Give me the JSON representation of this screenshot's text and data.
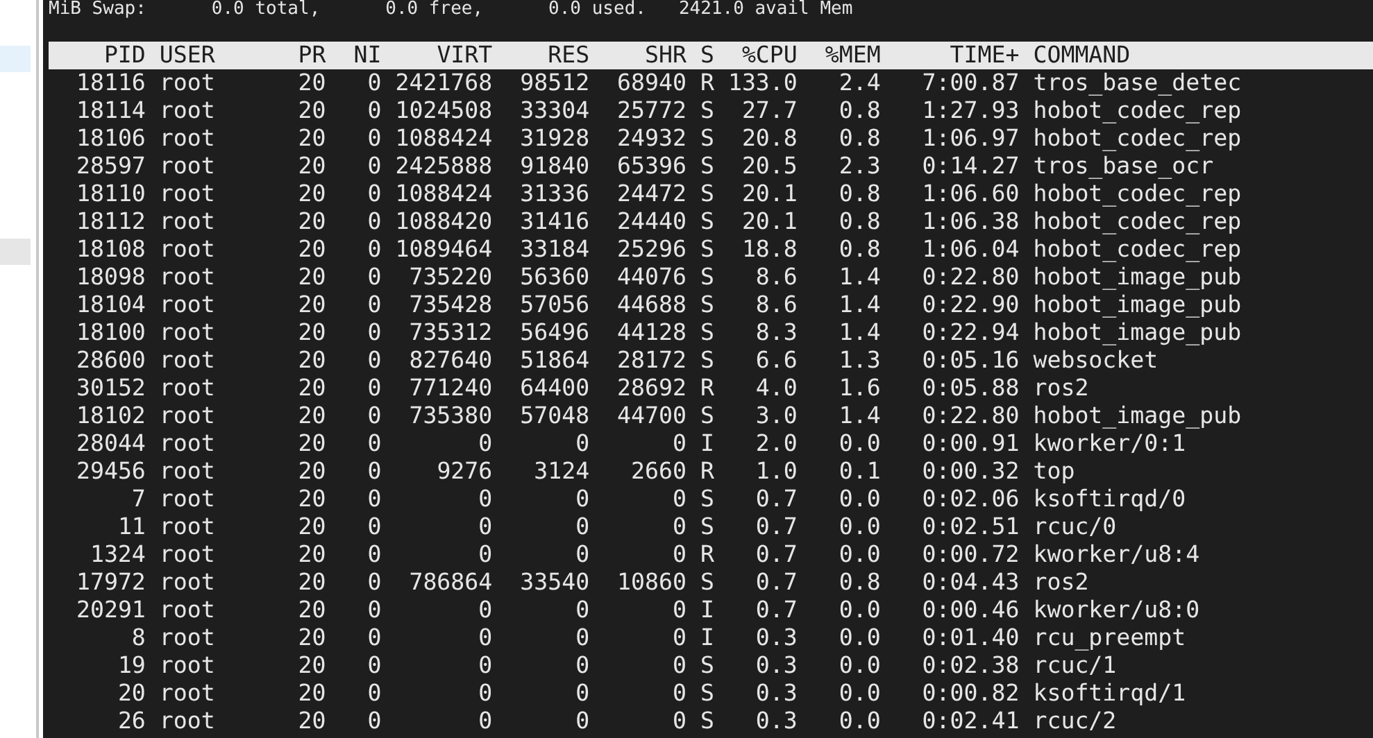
{
  "summary_line": "MiB Swap:      0.0 total,      0.0 free,      0.0 used.   2421.0 avail Mem",
  "columns": [
    "PID",
    "USER",
    "PR",
    "NI",
    "VIRT",
    "RES",
    "SHR",
    "S",
    "%CPU",
    "%MEM",
    "TIME+",
    "COMMAND"
  ],
  "rows": [
    [
      "18116",
      "root",
      "20",
      "0",
      "2421768",
      "98512",
      "68940",
      "R",
      "133.0",
      "2.4",
      "7:00.87",
      "tros_base_detec"
    ],
    [
      "18114",
      "root",
      "20",
      "0",
      "1024508",
      "33304",
      "25772",
      "S",
      "27.7",
      "0.8",
      "1:27.93",
      "hobot_codec_rep"
    ],
    [
      "18106",
      "root",
      "20",
      "0",
      "1088424",
      "31928",
      "24932",
      "S",
      "20.8",
      "0.8",
      "1:06.97",
      "hobot_codec_rep"
    ],
    [
      "28597",
      "root",
      "20",
      "0",
      "2425888",
      "91840",
      "65396",
      "S",
      "20.5",
      "2.3",
      "0:14.27",
      "tros_base_ocr"
    ],
    [
      "18110",
      "root",
      "20",
      "0",
      "1088424",
      "31336",
      "24472",
      "S",
      "20.1",
      "0.8",
      "1:06.60",
      "hobot_codec_rep"
    ],
    [
      "18112",
      "root",
      "20",
      "0",
      "1088420",
      "31416",
      "24440",
      "S",
      "20.1",
      "0.8",
      "1:06.38",
      "hobot_codec_rep"
    ],
    [
      "18108",
      "root",
      "20",
      "0",
      "1089464",
      "33184",
      "25296",
      "S",
      "18.8",
      "0.8",
      "1:06.04",
      "hobot_codec_rep"
    ],
    [
      "18098",
      "root",
      "20",
      "0",
      "735220",
      "56360",
      "44076",
      "S",
      "8.6",
      "1.4",
      "0:22.80",
      "hobot_image_pub"
    ],
    [
      "18104",
      "root",
      "20",
      "0",
      "735428",
      "57056",
      "44688",
      "S",
      "8.6",
      "1.4",
      "0:22.90",
      "hobot_image_pub"
    ],
    [
      "18100",
      "root",
      "20",
      "0",
      "735312",
      "56496",
      "44128",
      "S",
      "8.3",
      "1.4",
      "0:22.94",
      "hobot_image_pub"
    ],
    [
      "28600",
      "root",
      "20",
      "0",
      "827640",
      "51864",
      "28172",
      "S",
      "6.6",
      "1.3",
      "0:05.16",
      "websocket"
    ],
    [
      "30152",
      "root",
      "20",
      "0",
      "771240",
      "64400",
      "28692",
      "R",
      "4.0",
      "1.6",
      "0:05.88",
      "ros2"
    ],
    [
      "18102",
      "root",
      "20",
      "0",
      "735380",
      "57048",
      "44700",
      "S",
      "3.0",
      "1.4",
      "0:22.80",
      "hobot_image_pub"
    ],
    [
      "28044",
      "root",
      "20",
      "0",
      "0",
      "0",
      "0",
      "I",
      "2.0",
      "0.0",
      "0:00.91",
      "kworker/0:1"
    ],
    [
      "29456",
      "root",
      "20",
      "0",
      "9276",
      "3124",
      "2660",
      "R",
      "1.0",
      "0.1",
      "0:00.32",
      "top"
    ],
    [
      "7",
      "root",
      "20",
      "0",
      "0",
      "0",
      "0",
      "S",
      "0.7",
      "0.0",
      "0:02.06",
      "ksoftirqd/0"
    ],
    [
      "11",
      "root",
      "20",
      "0",
      "0",
      "0",
      "0",
      "S",
      "0.7",
      "0.0",
      "0:02.51",
      "rcuc/0"
    ],
    [
      "1324",
      "root",
      "20",
      "0",
      "0",
      "0",
      "0",
      "R",
      "0.7",
      "0.0",
      "0:00.72",
      "kworker/u8:4"
    ],
    [
      "17972",
      "root",
      "20",
      "0",
      "786864",
      "33540",
      "10860",
      "S",
      "0.7",
      "0.8",
      "0:04.43",
      "ros2"
    ],
    [
      "20291",
      "root",
      "20",
      "0",
      "0",
      "0",
      "0",
      "I",
      "0.7",
      "0.0",
      "0:00.46",
      "kworker/u8:0"
    ],
    [
      "8",
      "root",
      "20",
      "0",
      "0",
      "0",
      "0",
      "I",
      "0.3",
      "0.0",
      "0:01.40",
      "rcu_preempt"
    ],
    [
      "19",
      "root",
      "20",
      "0",
      "0",
      "0",
      "0",
      "S",
      "0.3",
      "0.0",
      "0:02.38",
      "rcuc/1"
    ],
    [
      "20",
      "root",
      "20",
      "0",
      "0",
      "0",
      "0",
      "S",
      "0.3",
      "0.0",
      "0:00.82",
      "ksoftirqd/1"
    ],
    [
      "26",
      "root",
      "20",
      "0",
      "0",
      "0",
      "0",
      "S",
      "0.3",
      "0.0",
      "0:02.41",
      "rcuc/2"
    ]
  ]
}
